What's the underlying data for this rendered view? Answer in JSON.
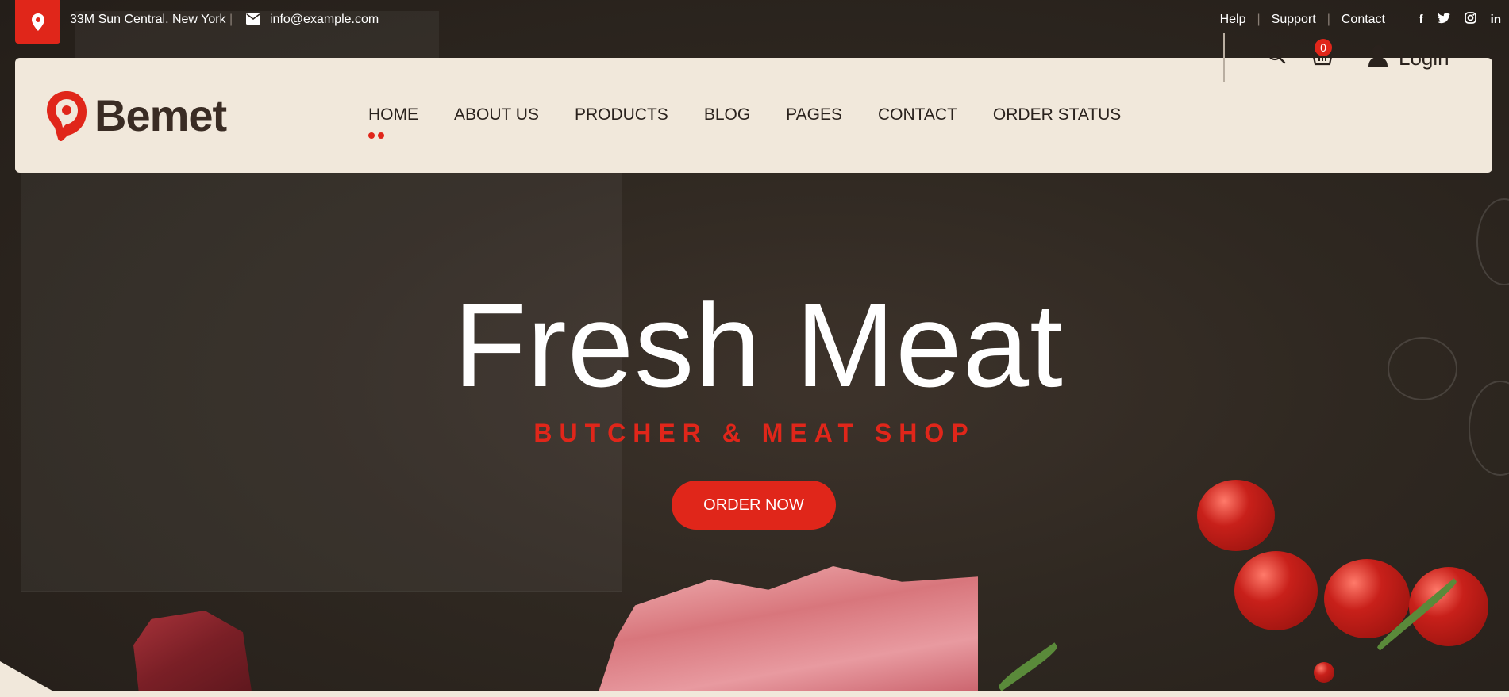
{
  "topbar": {
    "address": "33M Sun Central. New York",
    "email": "info@example.com",
    "links": [
      "Help",
      "Support",
      "Contact"
    ],
    "social_icons": [
      "facebook-icon",
      "twitter-icon",
      "instagram-icon",
      "linkedin-icon"
    ],
    "social_glyphs": [
      "f",
      "t",
      "◎",
      "in"
    ]
  },
  "header": {
    "logo_text": "Bemet",
    "nav": [
      "HOME",
      "ABOUT US",
      "PRODUCTS",
      "BLOG",
      "PAGES",
      "CONTACT",
      "ORDER STATUS"
    ],
    "cart_count": "0",
    "login_label": "Login"
  },
  "hero": {
    "title": "Fresh Meat",
    "subtitle": "BUTCHER & MEAT SHOP",
    "cta_label": "ORDER NOW"
  },
  "colors": {
    "accent": "#e0261a",
    "header_bg": "#f1e8db",
    "hero_bg": "#2e2620",
    "text_dark": "#2a221d"
  }
}
